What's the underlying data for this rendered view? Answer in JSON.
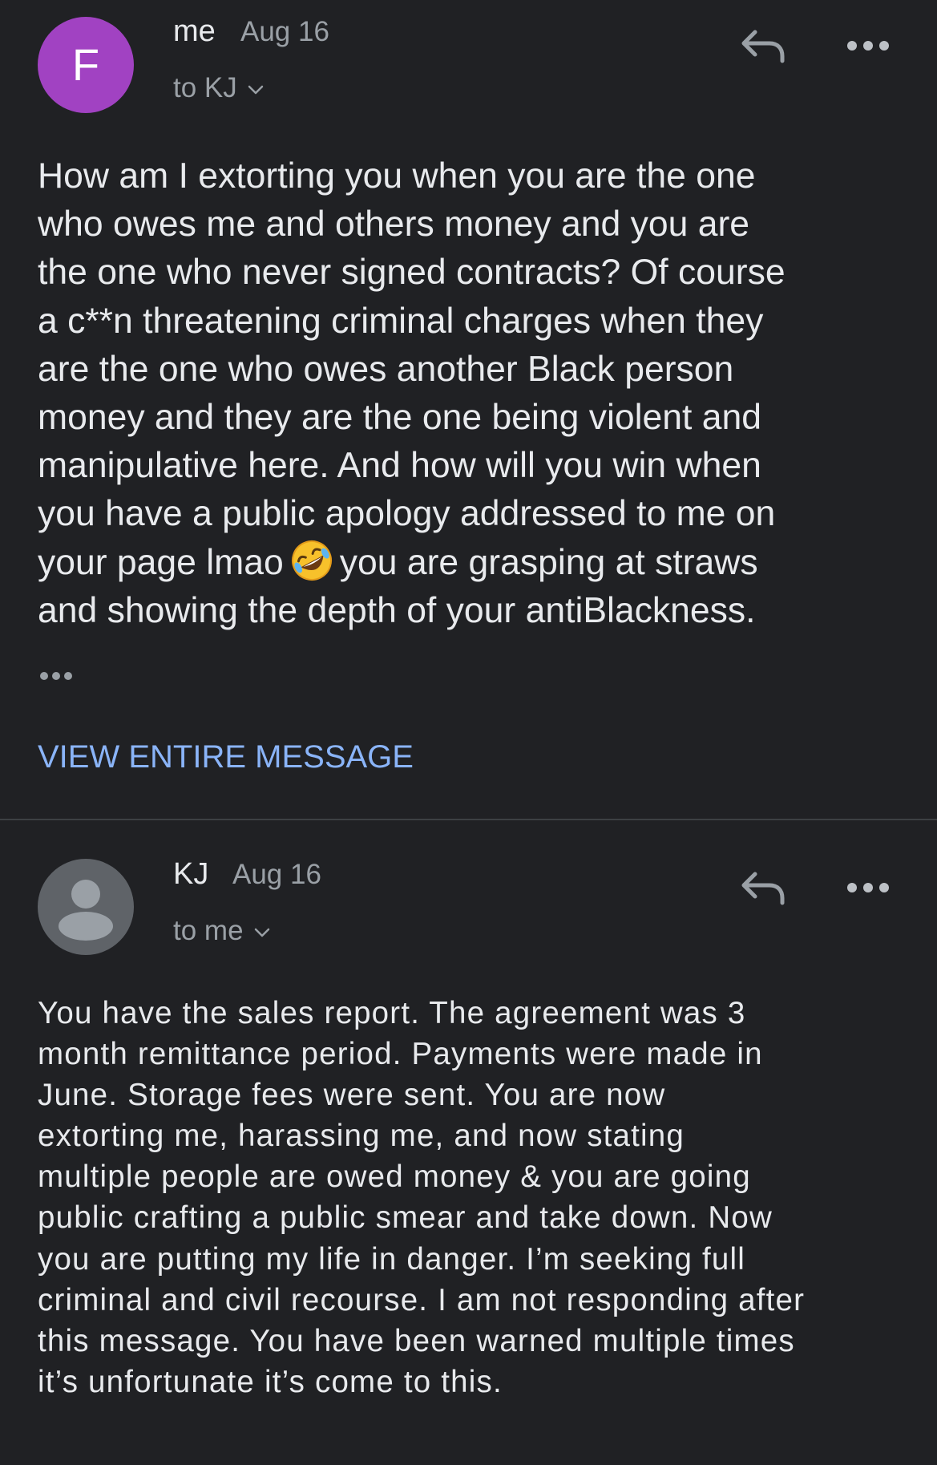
{
  "messages": [
    {
      "avatar_letter": "F",
      "avatar_color": "#a142c2",
      "sender": "me",
      "date": "Aug 16",
      "recipient": "to KJ",
      "body_before_emoji": "How am I extorting you when you are the one\nwho owes me and others money and you are\nthe one who never signed contracts? Of course\na c**n threatening criminal charges when they\nare the one who owes another Black person\nmoney and they are the one being violent and\nmanipulative here. And how will you win when\nyou have a public apology addressed to me on\nyour page lmao",
      "emoji_icon": "rolling-on-floor-laughing-emoji",
      "body_after_emoji": "you are grasping at straws\nand showing the depth of your antiBlackness.",
      "view_entire_label": "VIEW ENTIRE MESSAGE"
    },
    {
      "avatar_icon": "person-icon",
      "avatar_color": "#5f6368",
      "sender": "KJ",
      "date": "Aug 16",
      "recipient": "to me",
      "body": "You have the sales report. The agreement was 3\nmonth remittance period.  Payments were made in\nJune. Storage fees were sent.  You are now\nextorting me, harassing me, and now stating\nmultiple people are owed money & you are going\npublic crafting a public smear and take down. Now\nyou are putting my life in danger. I’m seeking full\ncriminal and civil recourse. I am not responding after\nthis message. You have been warned multiple times\nit’s unfortunate it’s come to this."
    }
  ],
  "icons": {
    "reply": "reply-icon",
    "more": "more-options-icon",
    "chevron": "chevron-down-icon",
    "ellipsis": "show-trimmed-content-icon"
  },
  "colors": {
    "background": "#202124",
    "primary_text": "#e8eaed",
    "secondary_text": "#9aa0a6",
    "link": "#8ab4f8",
    "divider": "#3c4043"
  }
}
